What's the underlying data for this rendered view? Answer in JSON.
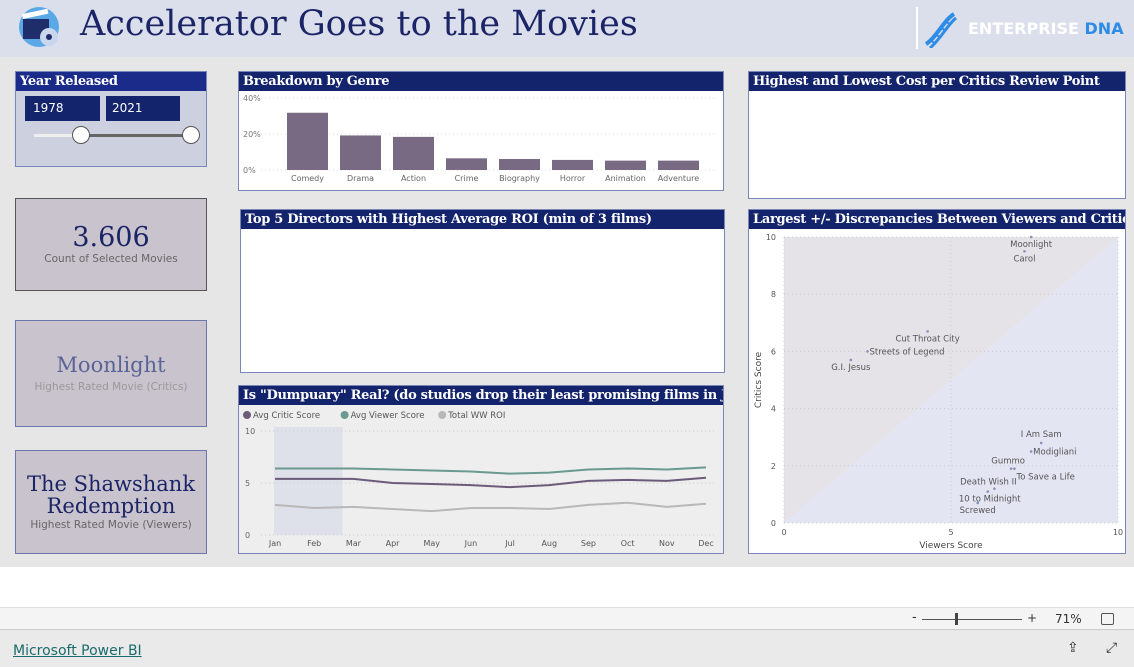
{
  "header": {
    "title": "Accelerator Goes to the Movies",
    "logo_text_1": "ENTERPRISE",
    "logo_text_2": "DNA",
    "icon": "movie-clapper-icon"
  },
  "colors": {
    "navy": "#13246c",
    "bar": "#786a82",
    "critic": "#6b5b7b",
    "viewer": "#6a9a8f",
    "roi": "#b8b8b8"
  },
  "year_slicer": {
    "title": "Year Released",
    "start": "1978",
    "end": "2021",
    "range_min": 1978,
    "range_max": 2021
  },
  "count_card": {
    "value": "3.606",
    "label": "Count of Selected Movies"
  },
  "critics_card": {
    "value": "Moonlight",
    "label": "Highest Rated Movie (Critics)"
  },
  "viewers_card": {
    "value": "The Shawshank Redemption",
    "label": "Highest Rated Movie (Viewers)"
  },
  "panels": {
    "genre": "Breakdown by Genre",
    "directors": "Top 5 Directors with Highest Average ROI (min of 3 films)",
    "dumpuary": "Is \"Dumpuary\" Real? (do studios drop their least promising films in Jan/Feb?)",
    "cost": "Highest and Lowest Cost per Critics Review Point",
    "discrepancy": "Largest +/- Discrepancies Between Viewers and Critics"
  },
  "chart_data": [
    {
      "type": "bar",
      "title": "Breakdown by Genre",
      "categories": [
        "Comedy",
        "Drama",
        "Action",
        "Crime",
        "Biography",
        "Horror",
        "Animation",
        "Adventure"
      ],
      "values": [
        31.8,
        19.2,
        18.4,
        6.5,
        6.1,
        5.6,
        5.2,
        5.2
      ],
      "yticks": [
        "0%",
        "20%",
        "40%"
      ],
      "ylim": [
        0,
        40
      ],
      "grid": true
    },
    {
      "type": "line",
      "title": "Is \"Dumpuary\" Real? (do studios drop their least promising films in Jan/Feb?)",
      "categories": [
        "Jan",
        "Feb",
        "Mar",
        "Apr",
        "May",
        "Jun",
        "Jul",
        "Aug",
        "Sep",
        "Oct",
        "Nov",
        "Dec"
      ],
      "yticks": [
        "0",
        "5",
        "10"
      ],
      "ylim": [
        0,
        10
      ],
      "legend": "top-left",
      "highlighted": [
        "Jan",
        "Feb"
      ],
      "series": [
        {
          "name": "Avg Critic Score",
          "values": [
            5.4,
            5.4,
            5.4,
            5.0,
            4.9,
            4.8,
            4.6,
            4.8,
            5.2,
            5.3,
            5.2,
            5.5
          ]
        },
        {
          "name": "Avg Viewer Score",
          "values": [
            6.4,
            6.4,
            6.4,
            6.3,
            6.2,
            6.1,
            5.9,
            6.0,
            6.3,
            6.4,
            6.3,
            6.5
          ]
        },
        {
          "name": "Total WW ROI",
          "values": [
            2.9,
            2.6,
            2.7,
            2.5,
            2.3,
            2.6,
            2.6,
            2.5,
            2.9,
            3.1,
            2.7,
            3.0
          ]
        }
      ]
    },
    {
      "type": "scatter",
      "title": "Largest +/- Discrepancies Between Viewers and Critics",
      "xlabel": "Viewers Score",
      "ylabel": "Critics Score",
      "xlim": [
        0,
        10
      ],
      "ylim": [
        0,
        10
      ],
      "xticks": [
        "0",
        "5",
        "10"
      ],
      "yticks": [
        "0",
        "2",
        "4",
        "6",
        "8",
        "10"
      ],
      "grid": true,
      "points": [
        {
          "label": "Moonlight",
          "x": 7.4,
          "y": 10.0
        },
        {
          "label": "Carol",
          "x": 7.2,
          "y": 9.5
        },
        {
          "label": "Cut Throat City",
          "x": 4.3,
          "y": 6.7
        },
        {
          "label": "Streets of Legend",
          "x": 2.5,
          "y": 6.0
        },
        {
          "label": "G.I. Jesus",
          "x": 2.0,
          "y": 5.7
        },
        {
          "label": "I Am Sam",
          "x": 7.7,
          "y": 2.8
        },
        {
          "label": "Modigliani",
          "x": 7.4,
          "y": 2.5
        },
        {
          "label": "Gummo",
          "x": 6.8,
          "y": 1.9
        },
        {
          "label": "To Save a Life",
          "x": 6.9,
          "y": 1.9
        },
        {
          "label": "Death Wish II",
          "x": 6.3,
          "y": 1.2
        },
        {
          "label": "10 to Midnight",
          "x": 6.1,
          "y": 1.1
        },
        {
          "label": "Screwed",
          "x": 5.8,
          "y": 0.7
        }
      ]
    }
  ],
  "zoom": {
    "minus": "-",
    "plus": "+",
    "level": "71%"
  },
  "footer": {
    "link": "Microsoft Power BI"
  }
}
